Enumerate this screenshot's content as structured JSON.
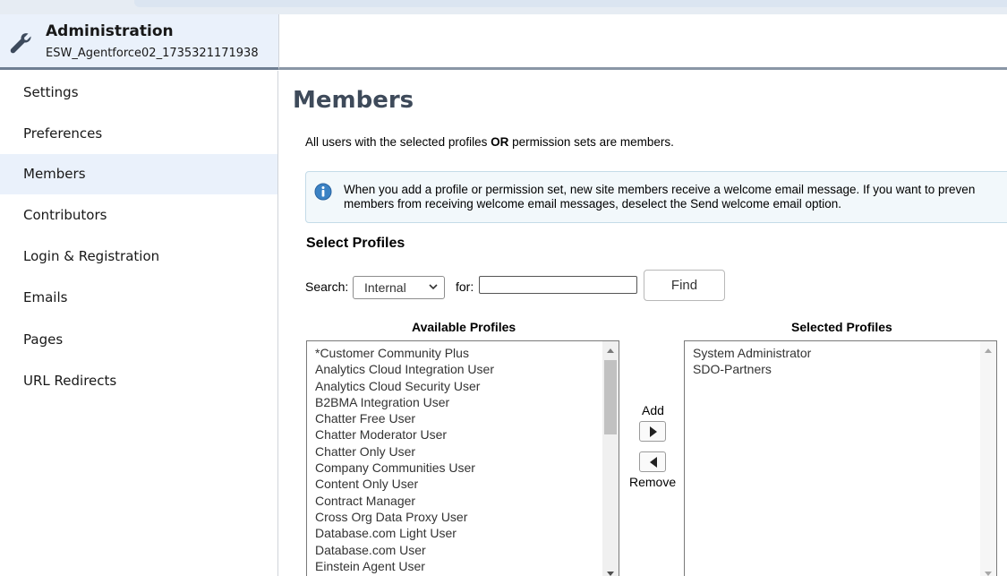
{
  "header": {
    "title": "Administration",
    "subtitle": "ESW_Agentforce02_1735321171938"
  },
  "sidebar": {
    "items": [
      {
        "label": "Settings"
      },
      {
        "label": "Preferences"
      },
      {
        "label": "Members",
        "active": true
      },
      {
        "label": "Contributors"
      },
      {
        "label": "Login & Registration"
      },
      {
        "label": "Emails"
      },
      {
        "label": "Pages"
      },
      {
        "label": "URL Redirects"
      }
    ]
  },
  "main": {
    "title": "Members",
    "desc_prefix": "All users with the selected profiles ",
    "desc_bold": "OR",
    "desc_suffix": " permission sets are members.",
    "info_line1": "When you add a profile or permission set, new site members receive a welcome email message. If you want to preven",
    "info_line2": "members from receiving welcome email messages, deselect the Send welcome email option.",
    "section_title": "Select Profiles",
    "search_label": "Search:",
    "search_select_value": "Internal",
    "for_label": "for:",
    "search_value": "",
    "find_label": "Find",
    "available_header": "Available Profiles",
    "selected_header": "Selected Profiles",
    "available_profiles": [
      "*Customer Community Plus",
      "Analytics Cloud Integration User",
      "Analytics Cloud Security User",
      "B2BMA Integration User",
      "Chatter Free User",
      "Chatter Moderator User",
      "Chatter Only User",
      "Company Communities User",
      "Content Only User",
      "Contract Manager",
      "Cross Org Data Proxy User",
      "Database.com Light User",
      "Database.com User",
      "Einstein Agent User"
    ],
    "selected_profiles": [
      "System Administrator",
      "SDO-Partners"
    ],
    "add_label": "Add",
    "remove_label": "Remove"
  },
  "colors": {
    "header_bg": "#eaf1fb",
    "active_nav_bg": "#eaf1fb",
    "title_color": "#3e4a5a",
    "info_bg": "#f2f8fb",
    "info_icon": "#3b82c4"
  },
  "icons": {
    "app": "wrench-icon",
    "info": "info-icon",
    "add": "arrow-right-icon",
    "remove": "arrow-left-icon"
  }
}
